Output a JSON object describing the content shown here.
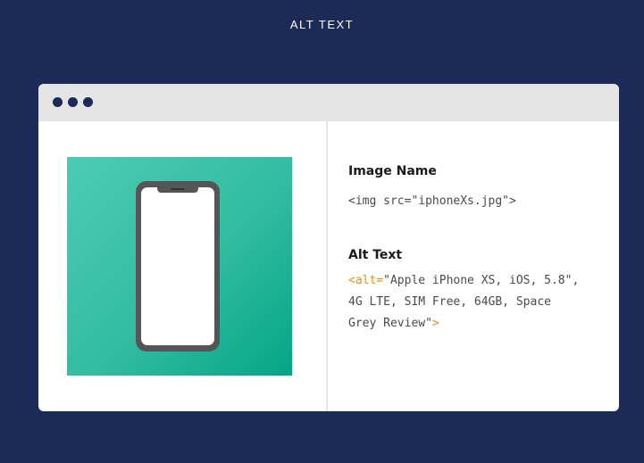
{
  "page": {
    "heading": "ALT TEXT"
  },
  "window": {
    "dots": [
      "dot",
      "dot",
      "dot"
    ]
  },
  "image_name": {
    "heading": "Image Name",
    "code": "<img src=\"iphoneXs.jpg\">"
  },
  "alt_text": {
    "heading": "Alt Text",
    "tag_open": "<alt=",
    "line1": "\"Apple iPhone XS, iOS, 5.8\",",
    "line2": "4G LTE, SIM Free, 64GB, Space",
    "line3": "Grey Review\"",
    "tag_close": ">"
  },
  "colors": {
    "background": "#1b2a57",
    "card": "#ffffff",
    "title_bar": "#e5e5e5",
    "image_panel_start": "#4ccbb3",
    "image_panel_end": "#04a586",
    "phone_frame": "#555555",
    "code_accent": "#e19215",
    "code_text": "#4a4a4a"
  },
  "icons": {
    "phone": "smartphone-icon"
  }
}
